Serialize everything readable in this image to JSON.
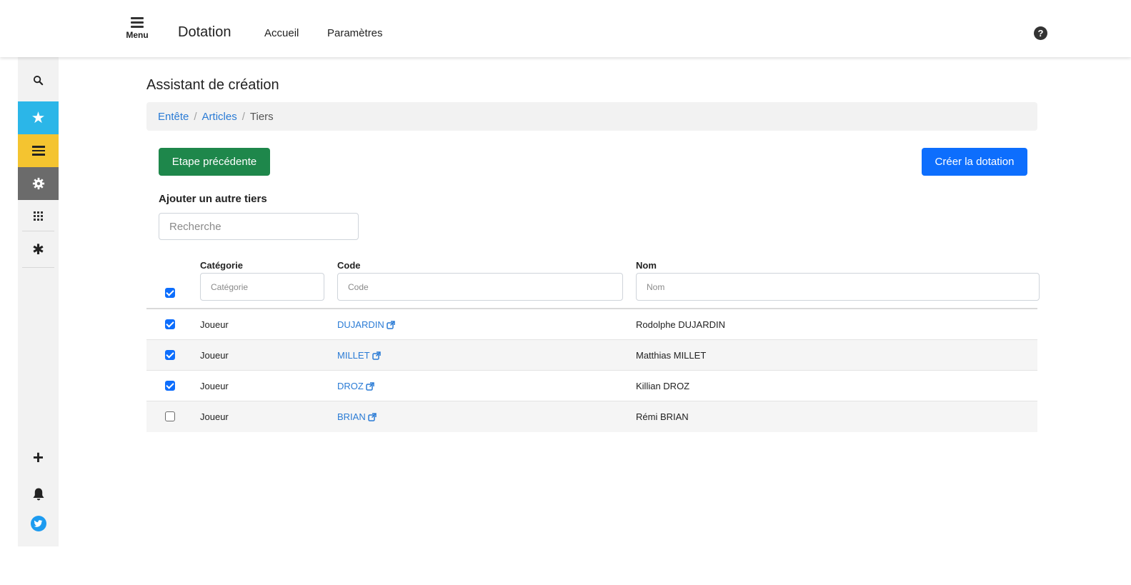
{
  "header": {
    "menu_label": "Menu",
    "app_title": "Dotation",
    "nav": [
      "Accueil",
      "Paramètres"
    ]
  },
  "sidebar": {
    "items": [
      "search-icon",
      "star-icon",
      "list-icon",
      "gear-icon",
      "grid-icon",
      "asterisk-icon",
      "plus-icon",
      "bell-icon",
      "twitter-icon"
    ],
    "colors": {
      "star": "#2bb6e8",
      "list": "#f4c430",
      "gear": "#6b6b6b",
      "twitter": "#1d9bf0"
    }
  },
  "main": {
    "title": "Assistant de création",
    "breadcrumb": [
      "Entête",
      "Articles",
      "Tiers"
    ],
    "prev_button": "Etape précédente",
    "create_button": "Créer la dotation",
    "add_label": "Ajouter un autre tiers",
    "search_placeholder": "Recherche"
  },
  "table": {
    "columns": [
      "Catégorie",
      "Code",
      "Nom"
    ],
    "filter_placeholders": [
      "Catégorie",
      "Code",
      "Nom"
    ],
    "header_checked": true,
    "rows": [
      {
        "checked": true,
        "categorie": "Joueur",
        "code": "DUJARDIN",
        "nom": "Rodolphe DUJARDIN"
      },
      {
        "checked": true,
        "categorie": "Joueur",
        "code": "MILLET",
        "nom": "Matthias MILLET"
      },
      {
        "checked": true,
        "categorie": "Joueur",
        "code": "DROZ",
        "nom": "Killian DROZ"
      },
      {
        "checked": false,
        "categorie": "Joueur",
        "code": "BRIAN",
        "nom": "Rémi BRIAN"
      }
    ]
  },
  "colors": {
    "link": "#2a7bd5",
    "primary": "#0d6efd",
    "success": "#1e874b"
  }
}
